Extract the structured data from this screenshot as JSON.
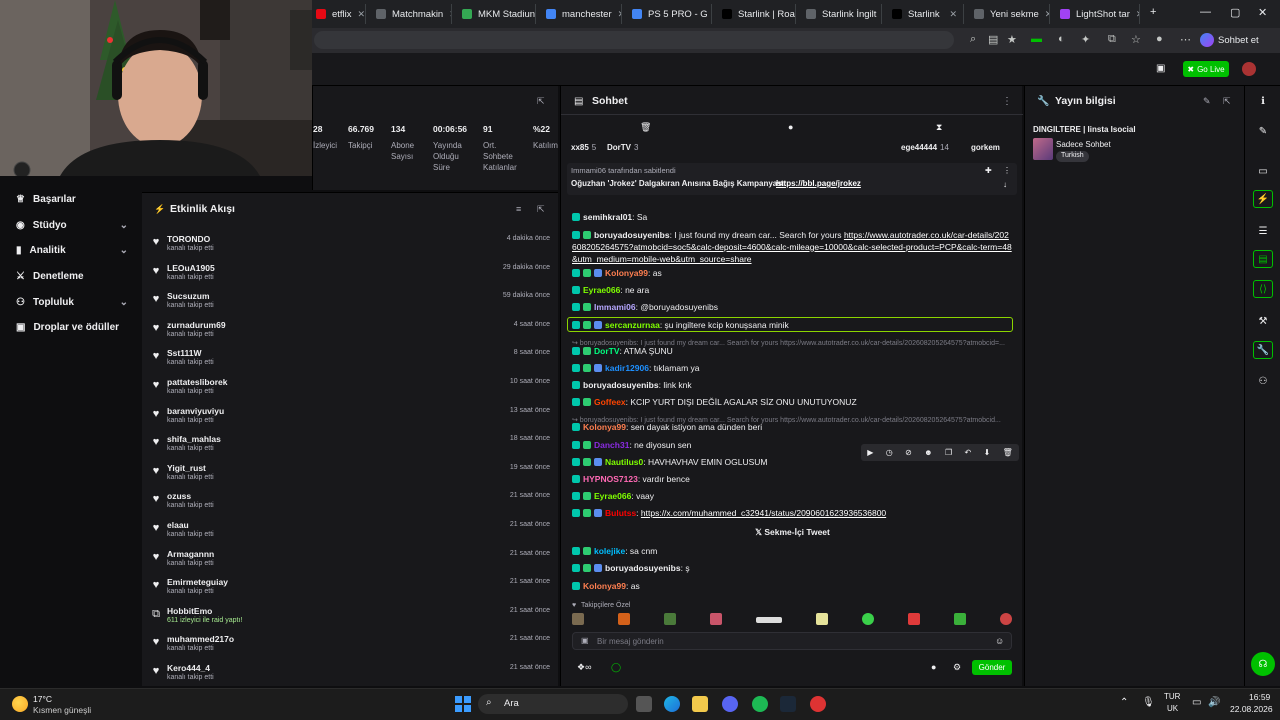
{
  "browser": {
    "tabs": [
      {
        "label": "etflix",
        "color": "#e50914"
      },
      {
        "label": "Matchmakin",
        "color": "#5f6368"
      },
      {
        "label": "MKM Stadiun",
        "color": "#34a853"
      },
      {
        "label": "manchester",
        "color": "#4285f4"
      },
      {
        "label": "PS 5 PRO - G",
        "color": "#4285f4"
      },
      {
        "label": "Starlink | Roa",
        "color": "#000000"
      },
      {
        "label": "Starlink İngilt",
        "color": "#5f6368"
      },
      {
        "label": "Starlink",
        "color": "#000000"
      },
      {
        "label": "Yeni sekme",
        "color": "#5f6368"
      },
      {
        "label": "LightShot tar",
        "color": "#a142f4"
      }
    ],
    "profile_label": "Sohbet et"
  },
  "topnav": {
    "golive_label": "Go Live"
  },
  "sidebar": {
    "items": [
      {
        "label": "Başarılar",
        "icon": "trophy-icon",
        "glyph": "♕"
      },
      {
        "label": "Stüdyo",
        "icon": "studio-icon",
        "glyph": "◉",
        "chev": "⌄"
      },
      {
        "label": "Analitik",
        "icon": "chart-icon",
        "glyph": "▮",
        "chev": "⌄"
      },
      {
        "label": "Denetleme",
        "icon": "sword-icon",
        "glyph": "⚔"
      },
      {
        "label": "Topluluk",
        "icon": "community-icon",
        "glyph": "⚇",
        "chev": "⌄"
      },
      {
        "label": "Droplar ve ödüller",
        "icon": "gift-icon",
        "glyph": "▣"
      }
    ]
  },
  "stats": {
    "items": [
      {
        "value": "28",
        "label": "İzleyici"
      },
      {
        "value": "66.769",
        "label": "Takipçi"
      },
      {
        "value": "134",
        "label": "Abone Sayısı"
      },
      {
        "value": "00:06:56",
        "label": "Yayında Olduğu Süre"
      },
      {
        "value": "91",
        "label": "Ort. Sohbete Katılanlar"
      },
      {
        "value": "%22",
        "label": "Katılım"
      }
    ]
  },
  "activity": {
    "title": "Etkinlik Akışı",
    "rows": [
      {
        "name": "TORONDO",
        "sub": "kanalı takip etti",
        "time": "4 dakika önce"
      },
      {
        "name": "LEOuA1905",
        "sub": "kanalı takip etti",
        "time": "29 dakika önce"
      },
      {
        "name": "Sucsuzum",
        "sub": "kanalı takip etti",
        "time": "59 dakika önce"
      },
      {
        "name": "zurnadurum69",
        "sub": "kanalı takip etti",
        "time": "4 saat önce"
      },
      {
        "name": "Sst111W",
        "sub": "kanalı takip etti",
        "time": "8 saat önce"
      },
      {
        "name": "pattatesliborek",
        "sub": "kanalı takip etti",
        "time": "10 saat önce"
      },
      {
        "name": "baranviyuviyu",
        "sub": "kanalı takip etti",
        "time": "13 saat önce"
      },
      {
        "name": "shifa_mahlas",
        "sub": "kanalı takip etti",
        "time": "18 saat önce"
      },
      {
        "name": "Yigit_rust",
        "sub": "kanalı takip etti",
        "time": "19 saat önce"
      },
      {
        "name": "ozuss",
        "sub": "kanalı takip etti",
        "time": "21 saat önce"
      },
      {
        "name": "elaau",
        "sub": "kanalı takip etti",
        "time": "21 saat önce"
      },
      {
        "name": "Armagannn",
        "sub": "kanalı takip etti",
        "time": "21 saat önce"
      },
      {
        "name": "Emirmeteguiay",
        "sub": "kanalı takip etti",
        "time": "21 saat önce"
      },
      {
        "name": "HobbitEmo",
        "sub": "611 izleyici ile raid yaptı!",
        "time": "21 saat önce",
        "raid": true
      },
      {
        "name": "muhammed217o",
        "sub": "kanalı takip etti",
        "time": "21 saat önce"
      },
      {
        "name": "Kero444_4",
        "sub": "kanalı takip etti",
        "time": "21 saat önce"
      }
    ]
  },
  "chat": {
    "title": "Sohbet",
    "top_bits": [
      {
        "name": "xx85",
        "value": "5"
      },
      {
        "name": "DorTV",
        "value": "3"
      },
      {
        "name": "ege44444",
        "value": "14"
      },
      {
        "name": "gorkem",
        "value": ""
      }
    ],
    "pinned_by": "Immami06 tarafından sabitlendi",
    "pinned_text": "Oğuzhan 'Jrokez' Dalgakıran Anısına Bağış Kampanyası:",
    "pinned_link": "https://bbl.page/jrokez",
    "messages": [
      {
        "user": "semihkral01",
        "color": "#efeff1",
        "text": "Sa"
      },
      {
        "user": "boruyadosuyenibs",
        "color": "#efeff1",
        "text": "I just found my dream car... Search for yours",
        "link": "https://www.autotrader.co.uk/car-details/202608205264575?atmobcid=soc5&calc-deposit=4600&calc-mileage=10000&calc-selected-product=PCP&calc-term=48&utm_medium=mobile-web&utm_source=share"
      },
      {
        "user": "Kolonya99",
        "color": "#ff7f50",
        "text": "as"
      },
      {
        "user": "Eyrae066",
        "color": "#7fff00",
        "text": "ne ara"
      },
      {
        "user": "Immami06",
        "color": "#b6a7ff",
        "text": "@boruyadosuyenibs"
      },
      {
        "user": "sercanzurnaa",
        "color": "#7fff00",
        "text": "şu ingiltere kcip konuşsana minik"
      },
      {
        "reply": "↪ boruyadosuyenibs: I just found my dream car... Search for yours https://www.autotrader.co.uk/car-details/202608205264575?atmobcid=..."
      },
      {
        "user": "DorTV",
        "color": "#00ff7f",
        "text": "ATMA ŞUNU"
      },
      {
        "user": "kadir12906",
        "color": "#1e90ff",
        "text": "tıklamam ya"
      },
      {
        "user": "boruyadosuyenibs",
        "color": "#efeff1",
        "text": "link knk"
      },
      {
        "user": "Goffeex",
        "color": "#ff4500",
        "text": "KCIP YURT DIŞI DEĞİL AGALAR SİZ ONU UNUTUYONUZ"
      },
      {
        "reply": "↪ boruyadosuyenibs: I just found my dream car... Search for yours https://www.autotrader.co.uk/car-details/202608205264575?atmobcid..."
      },
      {
        "user": "Kolonya99",
        "color": "#ff7f50",
        "text": "sen dayak istiyon ama dünden beri"
      },
      {
        "user": "Danch31",
        "color": "#8a2be2",
        "text": "ne diyosun sen"
      },
      {
        "user": "Nautilus0",
        "color": "#7fff00",
        "text": "HAVHAVHAV EMIN OGLUSUM"
      },
      {
        "user": "HYPNOS7123",
        "color": "#ff69b4",
        "text": "vardır bence"
      },
      {
        "user": "Eyrae066",
        "color": "#7fff00",
        "text": "vaay"
      },
      {
        "user": "Bulutss",
        "color": "#ff0000",
        "text": "",
        "link": "https://x.com/muhammed_c32941/status/2090601623936536800"
      },
      {
        "tweet": "Sekme-İçi Tweet"
      },
      {
        "user": "kolejike",
        "color": "#00bfff",
        "text": "sa cnm"
      },
      {
        "user": "boruyadosuyenibs",
        "color": "#efeff1",
        "text": "ş"
      },
      {
        "user": "Kolonya99",
        "color": "#ff7f50",
        "text": "as"
      }
    ],
    "follower_emotes_label": "Takipçilere Özel",
    "input_placeholder": "Bir mesaj gönderin",
    "send_label": "Gönder"
  },
  "stream_info": {
    "title": "Yayın bilgisi",
    "stream_title": "DINGILTERE | Iinsta Isocial",
    "mode": "Sadece Sohbet",
    "tag": "Turkish"
  },
  "taskbar": {
    "weather_temp": "17°C",
    "weather_desc": "Kısmen güneşli",
    "search_label": "Ara",
    "lang_line1": "TUR",
    "lang_line2": "UK",
    "time": "16:59",
    "date": "22.08.2026"
  }
}
